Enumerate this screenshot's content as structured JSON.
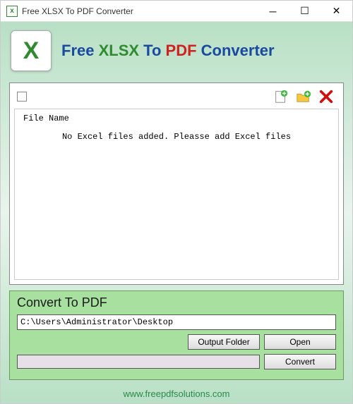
{
  "titlebar": {
    "icon_letter": "x",
    "title": "Free XLSX To PDF Converter"
  },
  "header": {
    "logo_letter": "X",
    "title_parts": {
      "p1": "Free ",
      "p2": "XLSX",
      "p3": " To ",
      "p4": "PDF",
      "p5": " Converter"
    }
  },
  "filelist": {
    "column_header": "File Name",
    "empty_message": "No Excel files added. Pleasse add Excel files"
  },
  "convert": {
    "title": "Convert To PDF",
    "path": "C:\\Users\\Administrator\\Desktop",
    "output_folder_btn": "Output Folder",
    "open_btn": "Open",
    "convert_btn": "Convert"
  },
  "footer": {
    "url": "www.freepdfsolutions.com"
  }
}
